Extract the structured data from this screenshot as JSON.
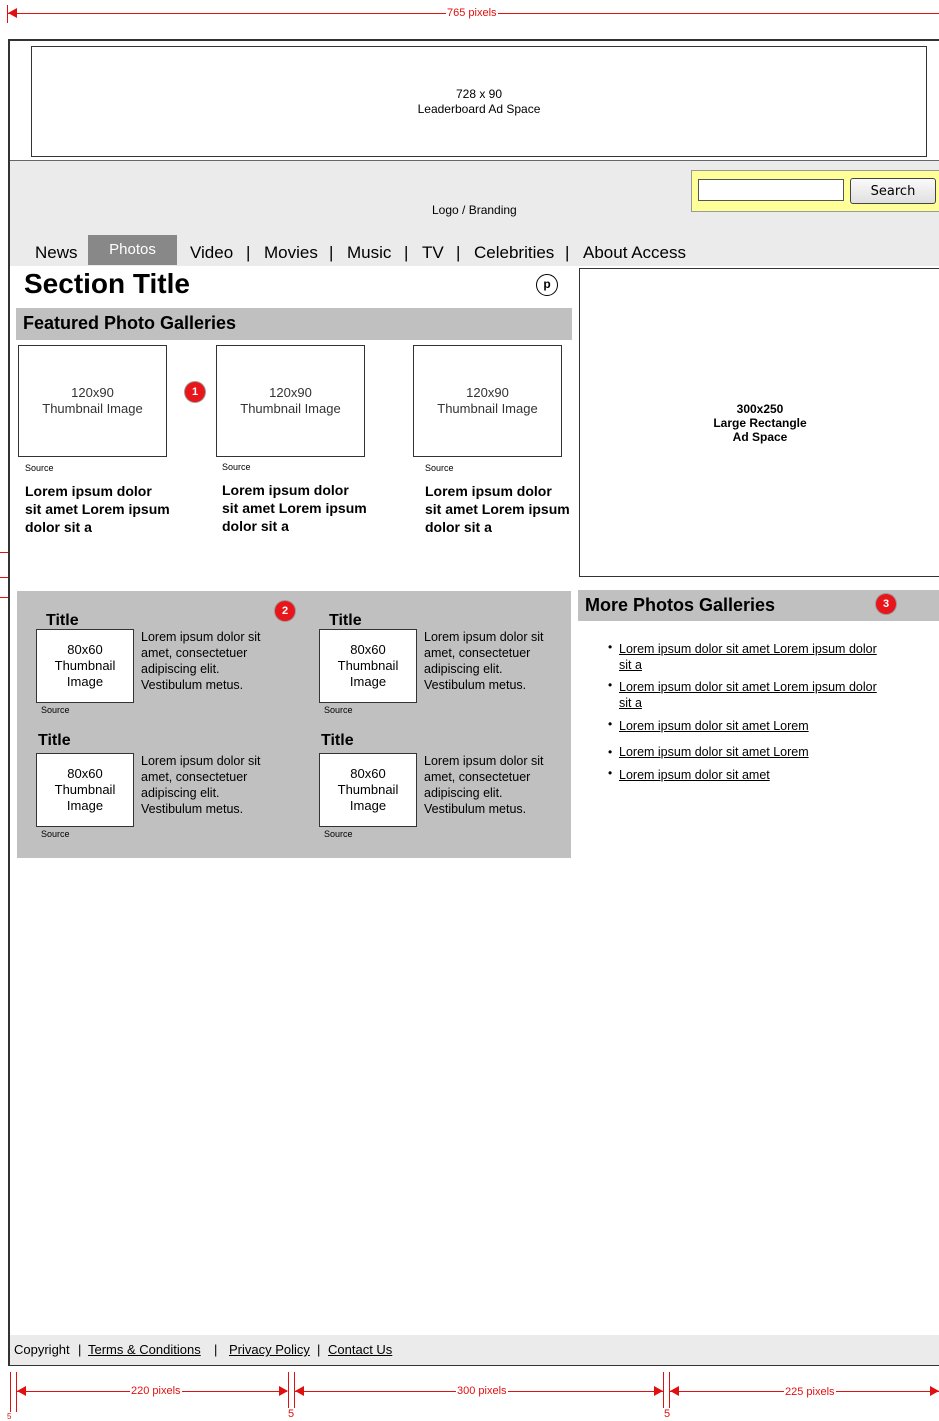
{
  "annotations": {
    "top_width": "765 pixels",
    "col1_width": "220 pixels",
    "col2_width": "300 pixels",
    "col3_width": "225 pixels",
    "gutter1": "5",
    "gutter2": "5",
    "gutter_left": "5"
  },
  "leaderboard": {
    "size": "728 x 90",
    "label": "Leaderboard Ad Space"
  },
  "header": {
    "logo": "Logo / Branding"
  },
  "search": {
    "placeholder": "",
    "button": "Search"
  },
  "nav": {
    "items": [
      "News",
      "Photos",
      "Video",
      "Movies",
      "Music",
      "TV",
      "Celebrities",
      "About Access"
    ],
    "separator": "|",
    "active": "Photos"
  },
  "section": {
    "title": "Section Title",
    "p_icon": "p"
  },
  "featured": {
    "heading": "Featured Photo Galleries",
    "badge": "1",
    "items": [
      {
        "thumb_size": "120x90",
        "thumb_label": "Thumbnail Image",
        "source": "Source",
        "title": "Lorem ipsum dolor sit amet Lorem ipsum dolor sit a"
      },
      {
        "thumb_size": "120x90",
        "thumb_label": "Thumbnail Image",
        "source": "Source",
        "title": "Lorem ipsum dolor sit amet Lorem ipsum dolor sit a"
      },
      {
        "thumb_size": "120x90",
        "thumb_label": "Thumbnail Image",
        "source": "Source",
        "title": "Lorem ipsum dolor sit amet Lorem ipsum dolor sit a"
      }
    ]
  },
  "galleries": {
    "badge": "2",
    "items": [
      {
        "title": "Title",
        "thumb": "80x60 Thumbnail Image",
        "source": "Source",
        "desc": "Lorem ipsum dolor sit amet, consectetuer adipiscing elit. Vestibulum metus."
      },
      {
        "title": "Title",
        "thumb": "80x60 Thumbnail Image",
        "source": "Source",
        "desc": "Lorem ipsum dolor sit amet, consectetuer adipiscing elit. Vestibulum metus."
      },
      {
        "title": "Title",
        "thumb": "80x60 Thumbnail Image",
        "source": "Source",
        "desc": "Lorem ipsum dolor sit amet, consectetuer adipiscing elit. Vestibulum metus."
      },
      {
        "title": "Title",
        "thumb": "80x60 Thumbnail Image",
        "source": "Source",
        "desc": "Lorem ipsum dolor sit amet, consectetuer adipiscing elit. Vestibulum metus."
      }
    ]
  },
  "rect_ad": {
    "size": "300x250",
    "line2": "Large Rectangle",
    "line3": "Ad Space"
  },
  "more": {
    "heading": "More Photos Galleries",
    "badge": "3",
    "links": [
      "Lorem ipsum dolor sit amet Lorem ipsum dolor sit a",
      "Lorem ipsum dolor sit amet Lorem ipsum dolor sit a",
      "Lorem ipsum dolor sit amet Lorem",
      "Lorem ipsum dolor sit amet Lorem",
      "Lorem ipsum dolor sit amet"
    ]
  },
  "footer": {
    "copyright": "Copyright",
    "links": [
      "Terms & Conditions",
      "Privacy Policy",
      "Contact Us"
    ],
    "separator": "|"
  },
  "colors": {
    "annotation": "#e01010",
    "badge": "#e8161b",
    "search_bg": "#ffff99",
    "nav_active": "#888888",
    "section_bar": "#c0c0c0",
    "header_bg": "#ebebeb"
  }
}
